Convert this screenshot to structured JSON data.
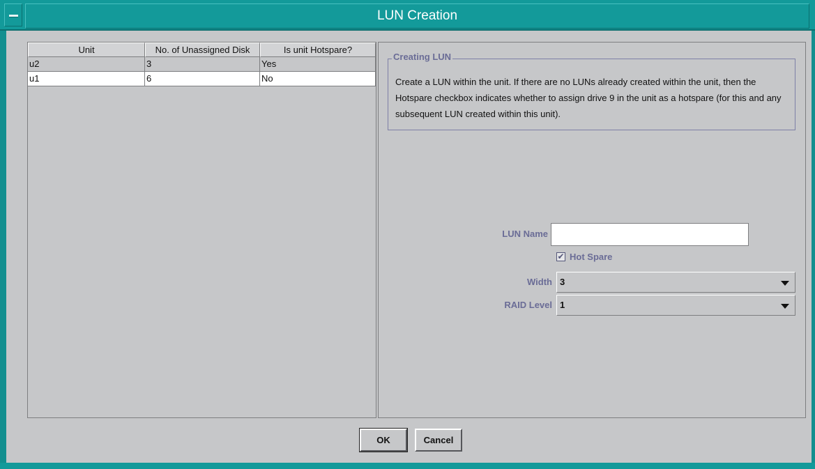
{
  "window": {
    "title": "LUN Creation"
  },
  "table": {
    "columns": [
      "Unit",
      "No. of Unassigned Disk",
      "Is unit Hotspare?"
    ],
    "rows": [
      [
        "u2",
        "3",
        "Yes"
      ],
      [
        "u1",
        "6",
        "No"
      ]
    ]
  },
  "info": {
    "title": "Creating LUN",
    "text": "Create a LUN within the unit.  If there are no LUNs already created within the unit, then the Hotspare checkbox indicates whether to assign drive 9 in the unit as a hotspare (for this and any subsequent LUN created within this unit)."
  },
  "form": {
    "lun_name_label": "LUN Name",
    "lun_name_value": "",
    "hot_spare_label": "Hot Spare",
    "hot_spare_checked": true,
    "check_glyph": "✔",
    "width_label": "Width",
    "width_value": "3",
    "raid_label": "RAID Level",
    "raid_value": "1"
  },
  "buttons": {
    "ok": "OK",
    "cancel": "Cancel"
  },
  "colors": {
    "titlebar": "#139a9a",
    "label": "#6a6c96",
    "background": "#c6c7c9"
  }
}
